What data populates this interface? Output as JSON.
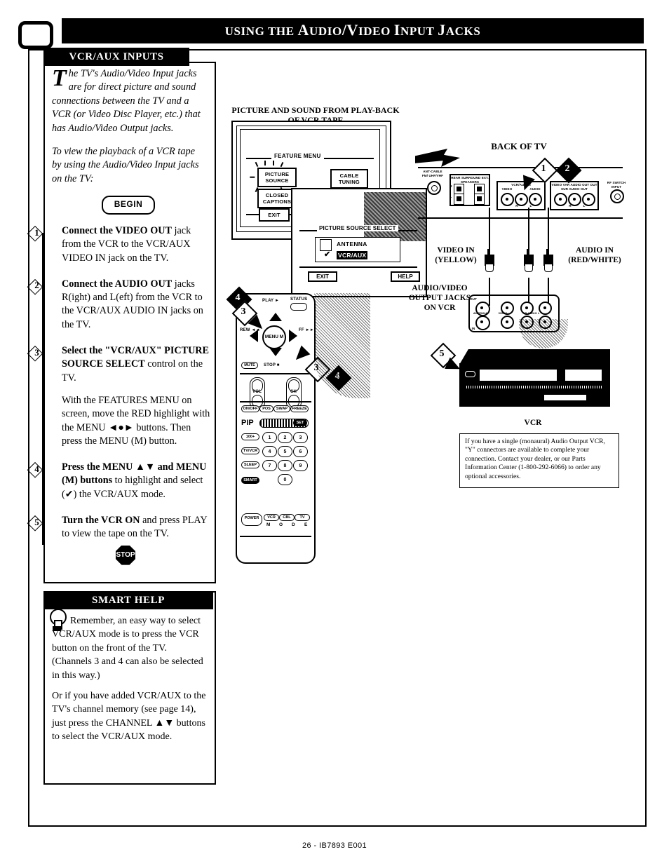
{
  "header": {
    "title_parts": [
      "U",
      "SING THE ",
      "A",
      "UDIO",
      "/V",
      "IDEO ",
      "I",
      "NPUT ",
      "J",
      "ACKS"
    ],
    "title": "USING THE AUDIO/VIDEO INPUT JACKS",
    "corner_icon": "tv-screen-icon"
  },
  "left_panel": {
    "heading": "VCR/AUX INPUTS",
    "intro_dropcap": "T",
    "intro_p1": "he TV's Audio/Video Input jacks are for direct picture and sound connections between the TV and a VCR (or Video Disc Player, etc.) that has Audio/Video Output jacks.",
    "intro_p2": "To view the playback of a VCR tape by using the Audio/Video Input jacks on the TV:",
    "begin_label": "BEGIN",
    "stop_label": "STOP",
    "steps": [
      {
        "number": "1",
        "bold": "Connect the VIDEO OUT",
        "rest": " jack from the VCR to the VCR/AUX VIDEO IN jack on the TV.",
        "sub": ""
      },
      {
        "number": "2",
        "bold": "Connect the AUDIO OUT",
        "rest": " jacks R(ight) and L(eft) from the VCR to the VCR/AUX AUDIO IN jacks on the TV.",
        "sub": ""
      },
      {
        "number": "3",
        "bold": "Select the \"VCR/AUX\" PICTURE SOURCE SELECT",
        "rest": " control on the TV.",
        "sub": "With the FEATURES MENU on screen, move the RED highlight with the MENU ◄●► buttons. Then press the MENU (M) button."
      },
      {
        "number": "4",
        "bold": "Press the MENU ▲▼ and MENU (M) buttons",
        "rest": " to highlight and select (✔) the VCR/AUX mode.",
        "sub": ""
      },
      {
        "number": "5",
        "bold": "Turn the VCR ON",
        "rest": " and press PLAY to view the tape  on the TV.",
        "sub": ""
      }
    ]
  },
  "smart_help": {
    "heading": "SMART HELP",
    "icon": "lightbulb-icon",
    "p1": "Remember, an easy way to select VCR/AUX mode is to press the VCR button on the front of the TV. (Channels 3 and 4 can also be selected in this way.)",
    "p2": "Or if you have added VCR/AUX to the TV's channel memory (see page 14), just press the CHANNEL ▲▼ buttons to select the VCR/AUX mode."
  },
  "diagram": {
    "tv_caption": "PICTURE AND SOUND FROM PLAY-BACK OF VCR TAPE",
    "back_of_tv_caption": "BACK OF TV",
    "vcr_caption": "VCR",
    "video_in_caption": "VIDEO IN (YELLOW)",
    "audio_in_caption": "AUDIO IN (RED/WHITE)",
    "vcr_jacks_caption": "AUDIO/VIDEO OUTPUT JACKS ON VCR",
    "feature_menu": {
      "title": "FEATURE MENU",
      "buttons": [
        "PICTURE SOURCE",
        "CLOSED CAPTIONS",
        "EXIT",
        "CABLE TUNING"
      ]
    },
    "picture_source_popup": {
      "title": "PICTURE SOURCE SELECT",
      "options": [
        "ANTENNA",
        "VCR/AUX"
      ],
      "selected": "VCR/AUX",
      "check_glyph": "✔",
      "exit_label": "EXIT",
      "help_label": "HELP"
    },
    "tv_back_panel": {
      "antenna_label": "ANT-CABLE FM/ UHF/VHF",
      "speakers_label": "REAR SURROUND EXT. SPEAKERS",
      "speakers_sub": [
        "R",
        "L"
      ],
      "vcraux_label": "VCR/AUX IN",
      "vcraux_sub": [
        "VIDEO",
        "AUDIO"
      ],
      "vcraux_rl": [
        "R",
        "L"
      ],
      "audio_out_label": "VIDEO VAR AUDIO OUT OUT  SUR AUDIO OUT",
      "audio_out_rl": [
        "R",
        "L"
      ],
      "rf_label": "RF SWITCH INPUT"
    },
    "vcr_jack_panel": {
      "rows": [
        "OUT",
        "IN"
      ],
      "groups": [
        "ANTENNA",
        "VIDEO",
        "R  AUDIO  L"
      ]
    },
    "remote": {
      "play_label": "PLAY ►",
      "status_label": "STATUS",
      "menu_label": "MENU M",
      "rew_label": "REW ◄◄",
      "ff_label": "FF ►►",
      "stop_label": "STOP ■",
      "mute_label": "MUTE",
      "vol_label": "VOL",
      "ch_label": "CH",
      "pip_label": "PIP",
      "pip_buttons": [
        "ON/OFF",
        "POS",
        "SWAP",
        "FREEZE"
      ],
      "pip_set": "SET",
      "keys": [
        "1",
        "2",
        "3",
        "4",
        "5",
        "6",
        "7",
        "8",
        "9",
        "0"
      ],
      "side_buttons": [
        "100+",
        "TV/VCR",
        "SLEEP",
        "SMART",
        "POWER"
      ],
      "mode_buttons": [
        "VCR",
        "CBL",
        "TV"
      ],
      "mode_letters": [
        "M",
        "O",
        "D",
        "E"
      ]
    },
    "markers": [
      "1",
      "2",
      "3",
      "4",
      "5"
    ],
    "note": "If you have a single (monaural) Audio Output VCR, \"Y\" connectors are available to complete your connection. Contact your dealer, or our Parts Information Center (1-800-292-6066) to order any optional accessories."
  },
  "footer": {
    "text": "26 - IB7893 E001"
  }
}
